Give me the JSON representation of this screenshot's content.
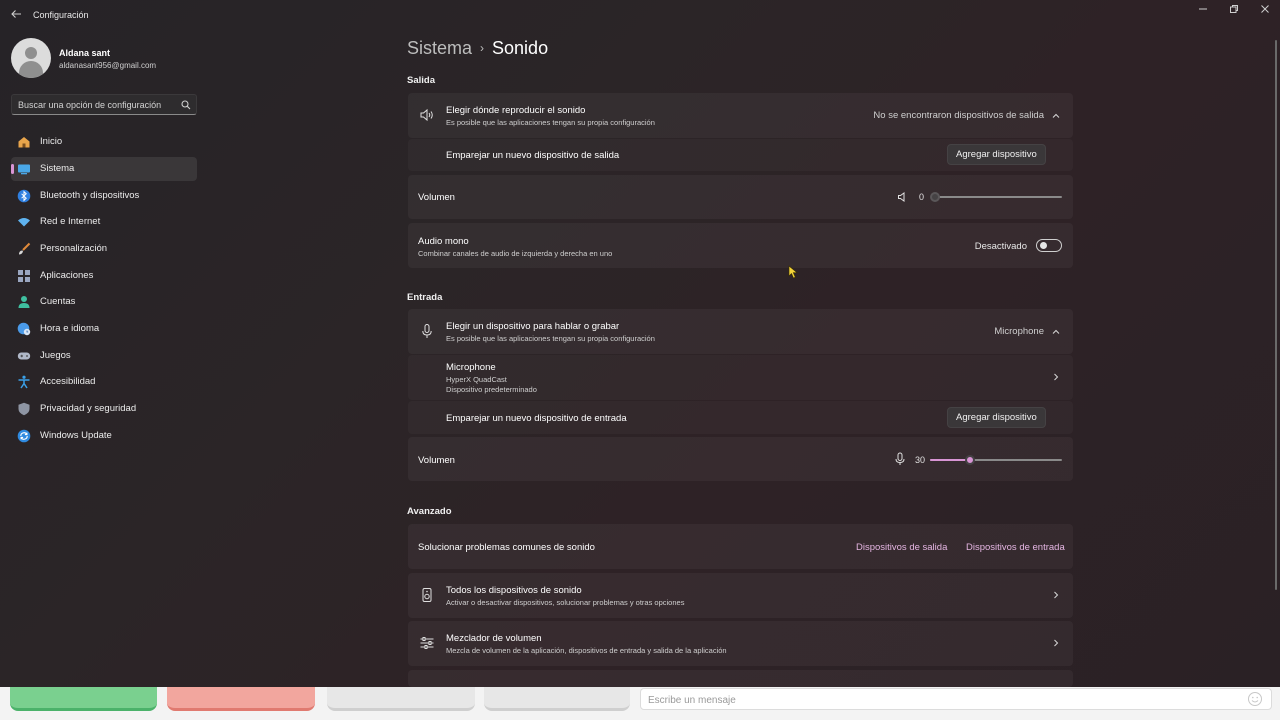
{
  "window": {
    "title": "Configuración",
    "back_icon": "back-arrow-icon"
  },
  "profile": {
    "name": "Aldana sant",
    "email": "aldanasant956@gmail.com"
  },
  "search": {
    "placeholder": "Buscar una opción de configuración"
  },
  "sidebar": {
    "items": [
      {
        "label": "Inicio",
        "icon": "home-icon",
        "color": "#e8a54b"
      },
      {
        "label": "Sistema",
        "icon": "system-icon",
        "color": "#4aa8e8",
        "active": true
      },
      {
        "label": "Bluetooth y dispositivos",
        "icon": "bluetooth-icon",
        "color": "#2f7fe0"
      },
      {
        "label": "Red e Internet",
        "icon": "wifi-icon",
        "color": "#5fb3f0"
      },
      {
        "label": "Personalización",
        "icon": "brush-icon",
        "color": "#e08a3a"
      },
      {
        "label": "Aplicaciones",
        "icon": "apps-icon",
        "color": "#9aa6c0"
      },
      {
        "label": "Cuentas",
        "icon": "person-icon",
        "color": "#3fc0a0"
      },
      {
        "label": "Hora e idioma",
        "icon": "globe-clock-icon",
        "color": "#4a9ae8"
      },
      {
        "label": "Juegos",
        "icon": "gamepad-icon",
        "color": "#b0b8c8"
      },
      {
        "label": "Accesibilidad",
        "icon": "accessibility-icon",
        "color": "#3aa0e8"
      },
      {
        "label": "Privacidad y seguridad",
        "icon": "shield-icon",
        "color": "#8e95a3"
      },
      {
        "label": "Windows Update",
        "icon": "update-icon",
        "color": "#2f8ae0"
      }
    ]
  },
  "breadcrumb": {
    "parent": "Sistema",
    "separator": "›",
    "current": "Sonido"
  },
  "output": {
    "section": "Salida",
    "choose_title": "Elegir dónde reproducir el sonido",
    "choose_sub": "Es posible que las aplicaciones tengan su propia configuración",
    "choose_value": "No se encontraron dispositivos de salida",
    "pair_label": "Emparejar un nuevo dispositivo de salida",
    "pair_button": "Agregar dispositivo",
    "volume_label": "Volumen",
    "volume_value": "0",
    "volume_level": 0,
    "mono_title": "Audio mono",
    "mono_sub": "Combinar canales de audio de izquierda y derecha en uno",
    "mono_state": "Desactivado",
    "mono_on": false
  },
  "input": {
    "section": "Entrada",
    "choose_title": "Elegir un dispositivo para hablar o grabar",
    "choose_sub": "Es posible que las aplicaciones tengan su propia configuración",
    "choose_value": "Microphone",
    "device_name": "Microphone",
    "device_model": "HyperX QuadCast",
    "device_status": "Dispositivo predeterminado",
    "pair_label": "Emparejar un nuevo dispositivo de entrada",
    "pair_button": "Agregar dispositivo",
    "volume_label": "Volumen",
    "volume_value": "30",
    "volume_level": 30
  },
  "advanced": {
    "section": "Avanzado",
    "troubleshoot_label": "Solucionar problemas comunes de sonido",
    "troubleshoot_output": "Dispositivos de salida",
    "troubleshoot_input": "Dispositivos de entrada",
    "all_devices_title": "Todos los dispositivos de sonido",
    "all_devices_sub": "Activar o desactivar dispositivos, solucionar problemas y otras opciones",
    "mixer_title": "Mezclador de volumen",
    "mixer_sub": "Mezcla de volumen de la aplicación, dispositivos de entrada y salida de la aplicación"
  },
  "chat": {
    "placeholder": "Escribe un mensaje"
  },
  "colors": {
    "accent": "#d895d4",
    "link": "#e5b5e2"
  }
}
